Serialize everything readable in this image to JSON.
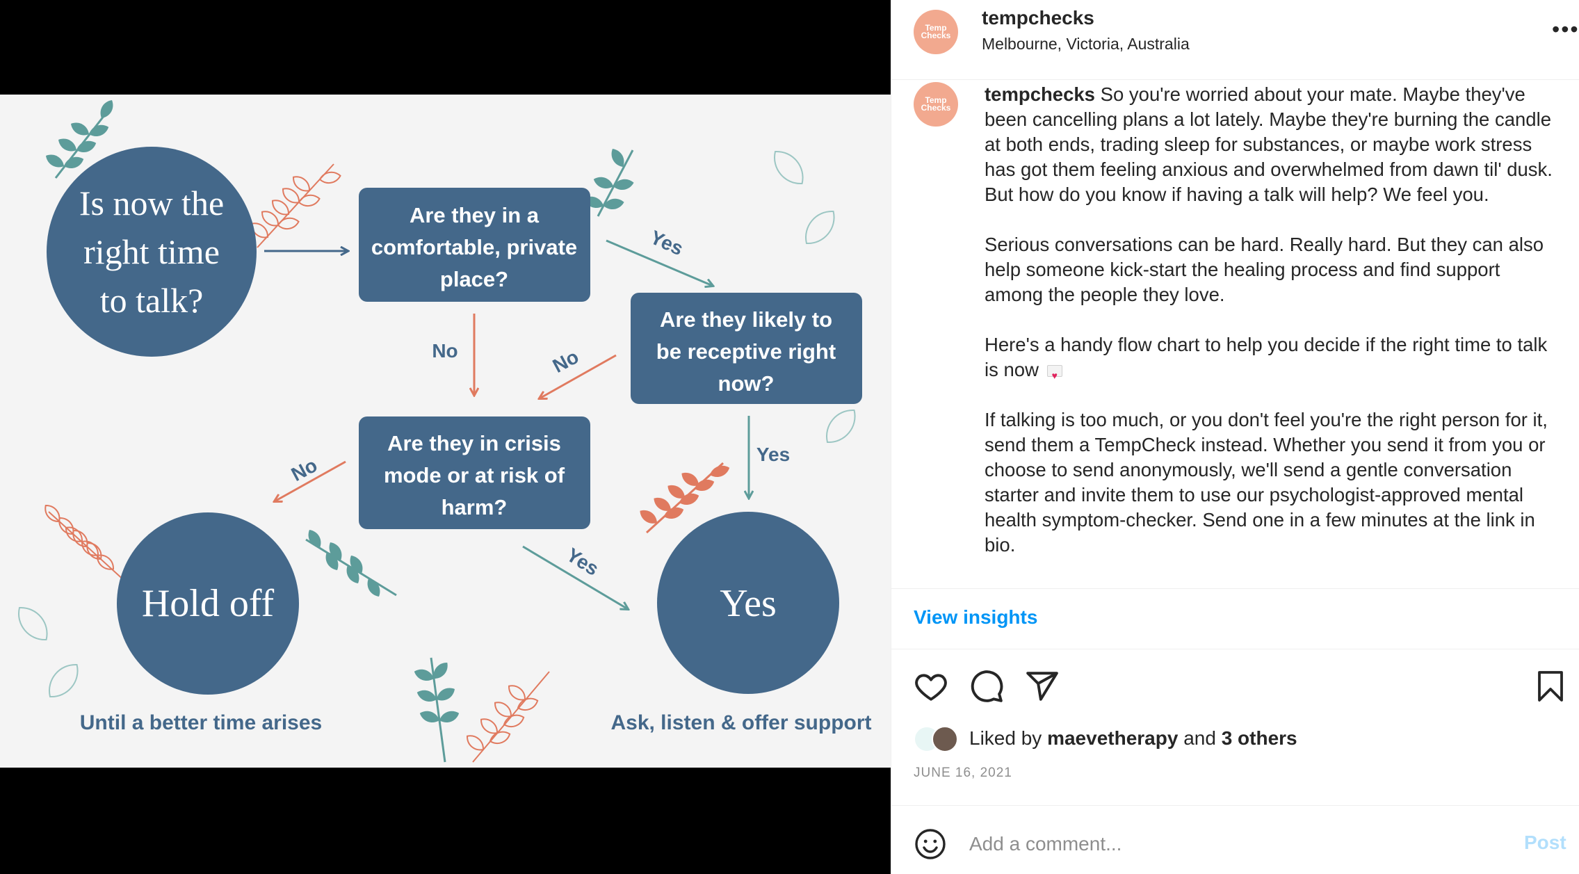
{
  "post": {
    "account": "tempchecks",
    "location": "Melbourne, Victoria, Australia",
    "avatar_text": "Temp Checks",
    "more_icon": "more-horizontal-icon",
    "colors": {
      "avatar": "#f2a98f",
      "link": "#0095f6",
      "post_disabled": "#b2dffc"
    }
  },
  "flowchart": {
    "colors": {
      "background": "#f4f4f4",
      "node": "#44688a",
      "arrow_blue": "#44688a",
      "arrow_coral": "#e07a5f",
      "arrow_teal": "#5d9c9a",
      "leaf_teal": "#5d9c9a",
      "leaf_coral": "#e07a5f"
    },
    "start_line1": "Is now the",
    "start_line2": "right time",
    "start_line3": "to talk?",
    "q1_line1": "Are they in a",
    "q1_line2": "comfortable, private",
    "q1_line3": "place?",
    "q2_line1": "Are they likely to",
    "q2_line2": "be receptive right",
    "q2_line3": "now?",
    "q3_line1": "Are they in crisis",
    "q3_line2": "mode or at risk of",
    "q3_line3": "harm?",
    "hold_off": "Hold off",
    "yes_end": "Yes",
    "hold_off_caption": "Until a better time arises",
    "yes_caption": "Ask, listen & offer support",
    "edge_q1_q2": "Yes",
    "edge_q1_q3": "No",
    "edge_q2_q3": "No",
    "edge_q2_yes": "Yes",
    "edge_q3_hold": "No",
    "edge_q3_yes": "Yes"
  },
  "caption": {
    "username": "tempchecks",
    "para1": "So you're worried about your mate. Maybe they've been cancelling plans a lot lately. Maybe they're burning the candle at both ends, trading sleep for substances, or maybe work stress has got them feeling anxious and overwhelmed from dawn til' dusk. But how do you know if having a talk will help? We feel you.",
    "para2": "Serious conversations can be hard. Really hard. But they can also help someone kick-start the healing process and find support among the people they love.",
    "para3": "Here's a handy flow chart to help you decide if the right time to talk is now",
    "para3_emoji": "love-letter-icon",
    "para4": "If talking is too much, or you don't feel you're the right person for it, send them a TempCheck instead. Whether you send it from you or choose to send anonymously, we'll send a gentle conversation starter and invite them to use our psychologist-approved mental health symptom-checker. Send one in a few minutes at the link in bio."
  },
  "insights_label": "View insights",
  "actions": {
    "like": "heart-icon",
    "comment": "comment-icon",
    "share": "send-icon",
    "save": "bookmark-icon"
  },
  "likes": {
    "prefix": "Liked by",
    "user": "maevetherapy",
    "and": "and",
    "others": "3 others"
  },
  "date": "JUNE 16, 2021",
  "comment": {
    "placeholder": "Add a comment...",
    "emoji_icon": "smiley-icon",
    "post_label": "Post"
  }
}
